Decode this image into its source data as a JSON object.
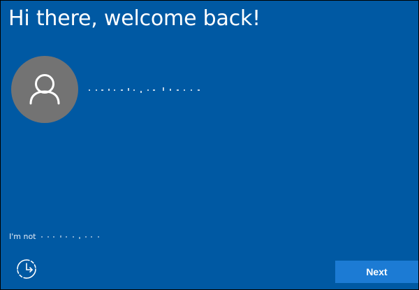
{
  "welcome": {
    "title": "Hi there, welcome back!"
  },
  "account": {
    "avatar_icon": "user-silhouette-icon",
    "name": ""
  },
  "switch_account": {
    "prefix": "I'm not",
    "name": ""
  },
  "footer": {
    "ease_of_access_icon": "ease-of-access-icon",
    "next_label": "Next"
  },
  "colors": {
    "background": "#0059a3",
    "avatar": "#737373",
    "button": "#1c7bd4",
    "text": "#ffffff"
  }
}
